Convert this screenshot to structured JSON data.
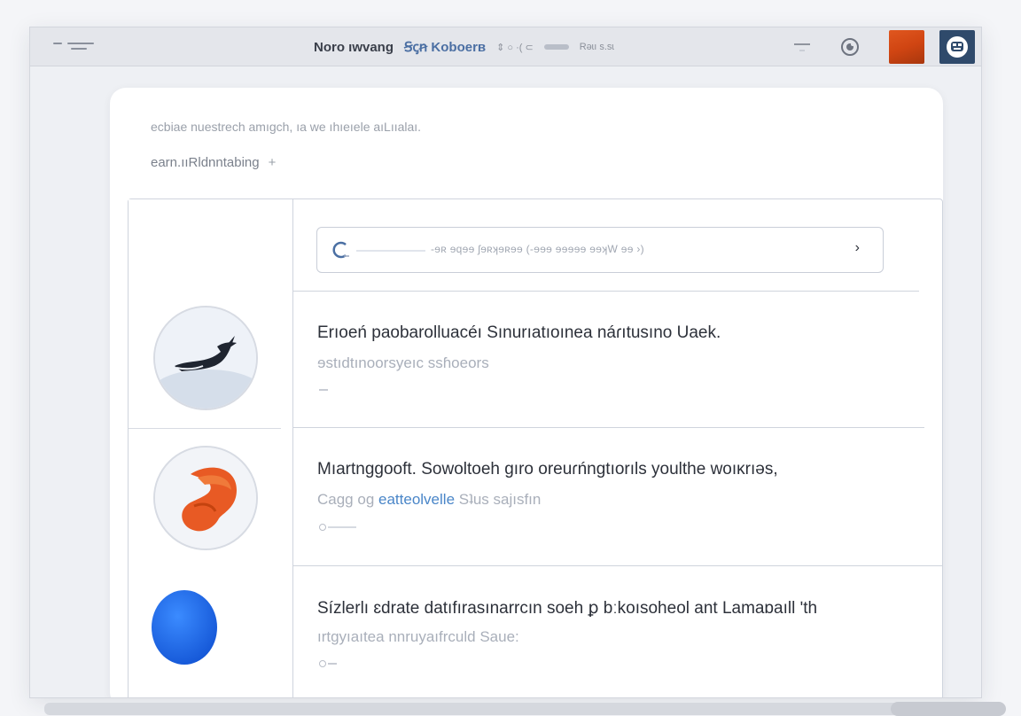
{
  "window": {
    "title": "Noro ıwvang",
    "subtitle": "Ꞩꞔꞥ Koboerв",
    "title_extra": "Rəɩı s.sɩ"
  },
  "header": {
    "description": "ecbiae nuestrech amıgch, ıa we ıhıeıele aıLııalaı.",
    "link_label": "earn.ııRldnntabing",
    "link_arrow": "+"
  },
  "search": {
    "placeholder": "‑ɘʀ ɘqɘɘ ʃɘʀʞɘʀɘɘ   (‑ɘɘɘ ɘɘɘɘɘ     ɘɘʞW ɘɘ ›)",
    "chevron": "›"
  },
  "items": [
    {
      "title": "Erıoeń paobarolluacéı Sınurıatıoınea náɾıtusıno Uaek.",
      "subtitle": "ɘstıdtınoorsyeıc ssɦoeors",
      "icon": "whale-tail-icon"
    },
    {
      "title": "Mıartnggooft. Sowoltoeh gıro oreuɾńngtıorıls youlthe woıĸrıəs,",
      "subtitle_a": "Cagg og",
      "subtitle_hl": "eatteolvelle",
      "subtitle_b": "Sʇus sajısfın",
      "icon": "orange-shell-icon"
    },
    {
      "title": "Sízlerlı ɛdrate datıfırasınarrcın soeh ꝑ bːkoısoheol ant Lamaɒaıll ʹth",
      "subtitle": "ırtgyıaıtea nnruyaıfrculd Saue:",
      "icon": "blue-circle-icon"
    }
  ],
  "colors": {
    "accent": "#4a86c8",
    "avatar": "#d04512",
    "user_badge": "#2f4a6b",
    "blue_circle": "#1f6ee8"
  }
}
